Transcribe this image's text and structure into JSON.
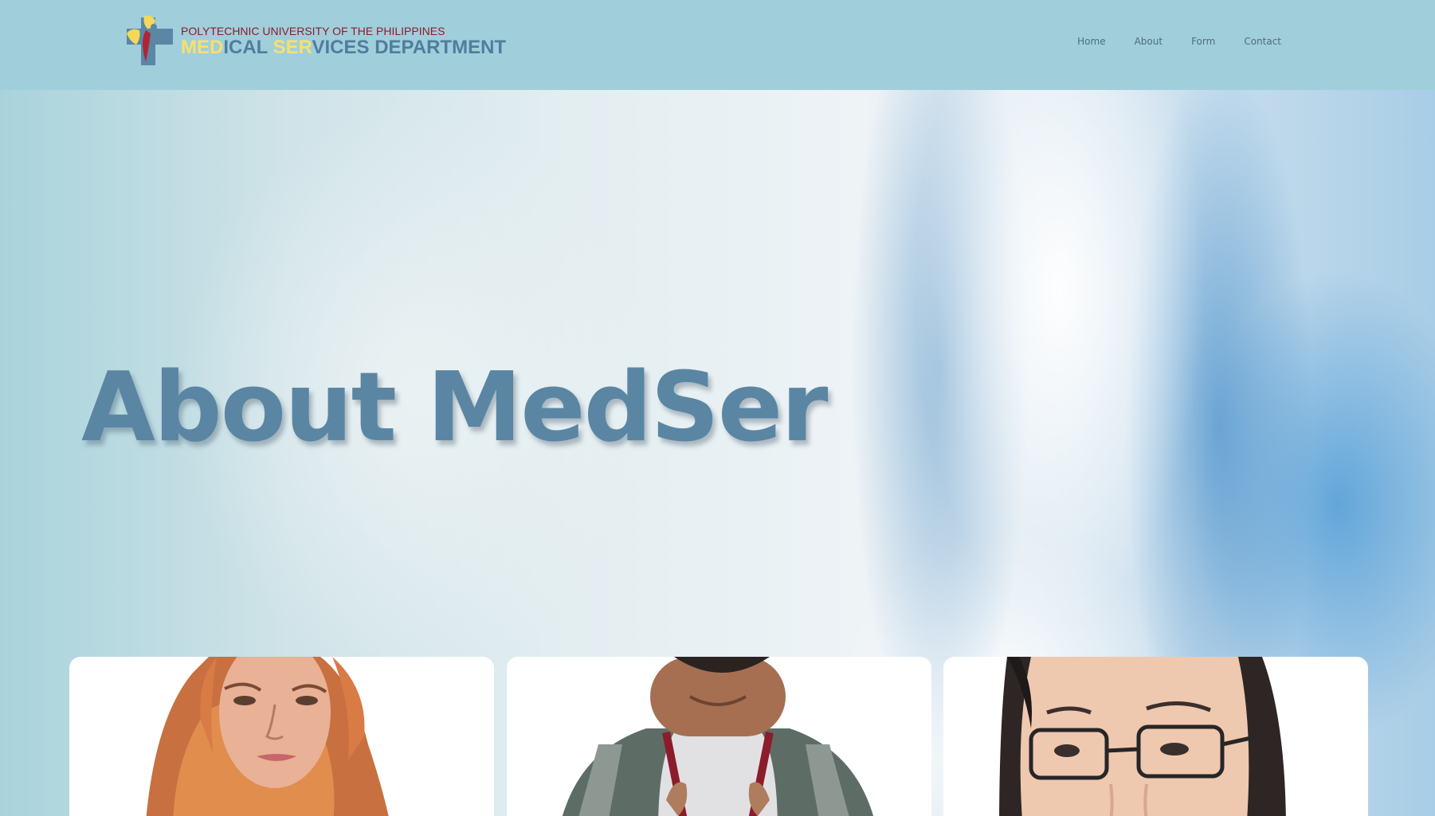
{
  "header": {
    "logo": {
      "line1": "POLYTECHNIC UNIVERSITY OF THE PHILIPPINES",
      "line2_parts": [
        "MED",
        "ICAL ",
        "SER",
        "VICES DEPARTMENT"
      ],
      "icon": "medical-cross-logo-icon"
    },
    "nav": [
      {
        "label": "Home"
      },
      {
        "label": "About"
      },
      {
        "label": "Form"
      },
      {
        "label": "Contact"
      }
    ]
  },
  "hero": {
    "title": "About MedSer"
  },
  "team_cards": [
    {
      "photo": "team-member-photo-1"
    },
    {
      "photo": "team-member-photo-2"
    },
    {
      "photo": "team-member-photo-3"
    }
  ],
  "colors": {
    "header_bg": "#a0cfdb",
    "title": "#5a86a4",
    "nav_text": "#4f6c82",
    "logo_yellow": "#f7e070",
    "logo_blue": "#4f7d9f",
    "logo_red": "#8b1c2c"
  }
}
